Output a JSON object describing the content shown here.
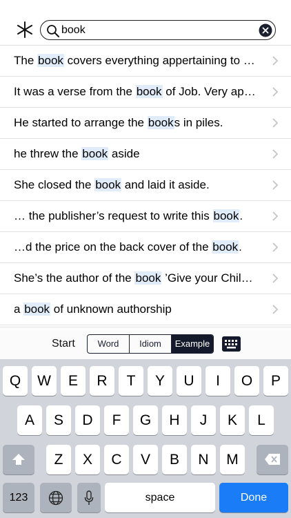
{
  "search": {
    "value": "book"
  },
  "results": [
    {
      "before": "The ",
      "match": "book",
      "after": " covers everything appertaining to …"
    },
    {
      "before": "It was a verse from the ",
      "match": "book",
      "after": " of Job. Very ap…"
    },
    {
      "before": "He started to arrange the ",
      "match": "book",
      "after": "s in piles."
    },
    {
      "before": "he threw the ",
      "match": "book",
      "after": " aside"
    },
    {
      "before": "She closed the ",
      "match": "book",
      "after": " and laid it aside."
    },
    {
      "before": "… the publisher’s request to write this ",
      "match": "book",
      "after": "."
    },
    {
      "before": "…d the price on the back cover of the ",
      "match": "book",
      "after": "."
    },
    {
      "before": "She’s the author of the ",
      "match": "book",
      "after": " ’Give your Chil…"
    },
    {
      "before": "a ",
      "match": "book",
      "after": " of unknown authorship"
    }
  ],
  "modebar": {
    "start": "Start",
    "segments": [
      "Word",
      "Idiom",
      "Example"
    ],
    "active_segment": "Example"
  },
  "keyboard": {
    "row1": [
      "Q",
      "W",
      "E",
      "R",
      "T",
      "Y",
      "U",
      "I",
      "O",
      "P"
    ],
    "row2": [
      "A",
      "S",
      "D",
      "F",
      "G",
      "H",
      "J",
      "K",
      "L"
    ],
    "row3": [
      "Z",
      "X",
      "C",
      "V",
      "B",
      "N",
      "M"
    ],
    "numbers_label": "123",
    "space_label": "space",
    "done_label": "Done"
  },
  "colors": {
    "accent": "#1a7cf7",
    "highlight": "#e0ecf9",
    "segment_dark": "#141a2b"
  },
  "icons": [
    "asterisk-icon",
    "search-icon",
    "clear-icon",
    "chevron-right-icon",
    "keyboard-icon",
    "shift-icon",
    "backspace-icon",
    "globe-icon",
    "microphone-icon"
  ]
}
